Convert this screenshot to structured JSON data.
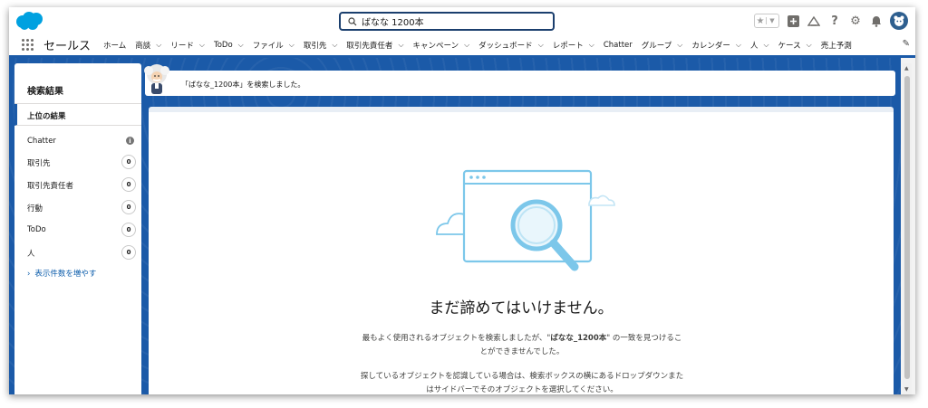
{
  "search": {
    "value": "ばなな 1200本"
  },
  "nav": {
    "app_name": "セールス",
    "items": [
      {
        "label": "ホーム",
        "chevron": false
      },
      {
        "label": "商談",
        "chevron": true
      },
      {
        "label": "リード",
        "chevron": true
      },
      {
        "label": "ToDo",
        "chevron": true
      },
      {
        "label": "ファイル",
        "chevron": true
      },
      {
        "label": "取引先",
        "chevron": true
      },
      {
        "label": "取引先責任者",
        "chevron": true
      },
      {
        "label": "キャンペーン",
        "chevron": true
      },
      {
        "label": "ダッシュボード",
        "chevron": true
      },
      {
        "label": "レポート",
        "chevron": true
      },
      {
        "label": "Chatter",
        "chevron": false
      },
      {
        "label": "グループ",
        "chevron": true
      },
      {
        "label": "カレンダー",
        "chevron": true
      },
      {
        "label": "人",
        "chevron": true
      },
      {
        "label": "ケース",
        "chevron": true
      },
      {
        "label": "売上予測",
        "chevron": false
      }
    ]
  },
  "sidebar": {
    "title": "検索結果",
    "top_results": "上位の結果",
    "items": [
      {
        "label": "Chatter",
        "count": "i"
      },
      {
        "label": "取引先",
        "count": "0"
      },
      {
        "label": "取引先責任者",
        "count": "0"
      },
      {
        "label": "行動",
        "count": "0"
      },
      {
        "label": "ToDo",
        "count": "0"
      },
      {
        "label": "人",
        "count": "0"
      }
    ],
    "more": "表示件数を増やす"
  },
  "banner": {
    "text": "「ばなな_1200本」を検索しました。"
  },
  "empty": {
    "headline": "まだ諦めてはいけません。",
    "p1_before": "最もよく使用されるオブジェクトを検索しましたが、\"",
    "p1_term": "ばなな_1200本",
    "p1_after": "\" の一致を見つけることができませんでした。",
    "p2": "探しているオブジェクトを認識している場合は、検索ボックスの横にあるドロップダウンまたはサイドバーでそのオブジェクトを選択してください。"
  },
  "colors": {
    "brand": "#1b5aa8",
    "logo": "#00a1e0",
    "link": "#0b5cab"
  }
}
